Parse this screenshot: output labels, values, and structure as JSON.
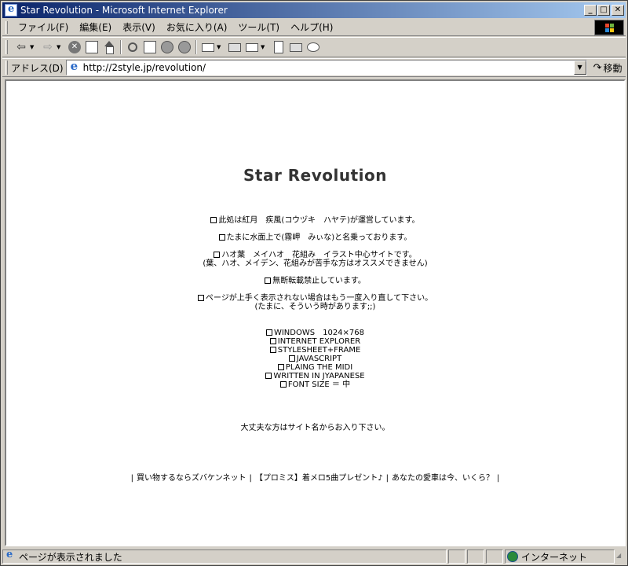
{
  "window": {
    "title": "Star Revolution - Microsoft Internet Explorer",
    "minimize_label": "_",
    "maximize_label": "□",
    "close_label": "✕"
  },
  "menu": {
    "items": [
      {
        "label": "ファイル(F)"
      },
      {
        "label": "編集(E)"
      },
      {
        "label": "表示(V)"
      },
      {
        "label": "お気に入り(A)"
      },
      {
        "label": "ツール(T)"
      },
      {
        "label": "ヘルプ(H)"
      }
    ]
  },
  "toolbar": {
    "icons": [
      "back-icon",
      "forward-icon",
      "stop-icon",
      "refresh-icon",
      "home-icon",
      "search-icon",
      "favorites-icon",
      "history-icon",
      "media-icon",
      "mail-icon",
      "print-icon",
      "edit-icon",
      "discuss-icon",
      "messenger-icon"
    ]
  },
  "address": {
    "label": "アドレス(D)",
    "value": "http://2style.jp/revolution/",
    "go_label": "移動"
  },
  "page": {
    "title": "Star Revolution",
    "lines": [
      "此処は紅月　疾風(コウヅキ　ハヤテ)が運営しています。",
      "たまに水面上で(霧岬　みぃな)と名乗っております。",
      "ハオ葉　メイハオ　花組み　イラスト中心サイトです。",
      "(葉、ハオ、メイデン、花組みが苦手な方はオススメできません)",
      "無断転載禁止しています。",
      "ページが上手く表示されない場合はもう一度入り直して下さい。",
      "(たまに、そういう時があります;;)"
    ],
    "env": [
      "WINDOWS　1024×768",
      "INTERNET EXPLORER",
      "STYLESHEET+FRAME",
      "JAVASCRIPT",
      "PLAING THE MIDI",
      "WRITTEN IN JYAPANESE",
      "FONT SIZE ＝ 中"
    ],
    "enter_text": "大丈夫な方はサイト名からお入り下さい。",
    "footer_links": [
      "買い物するならズバケンネット",
      "【プロミス】着メロ5曲プレゼント♪",
      "あなたの愛車は今、いくら？"
    ],
    "footer_pipe": "|"
  },
  "status": {
    "text": "ページが表示されました",
    "zone": "インターネット"
  },
  "colors": {
    "titlebar_start": "#0a246a",
    "titlebar_end": "#a6caf0",
    "chrome": "#d4d0c8",
    "title_text": "#333333"
  }
}
